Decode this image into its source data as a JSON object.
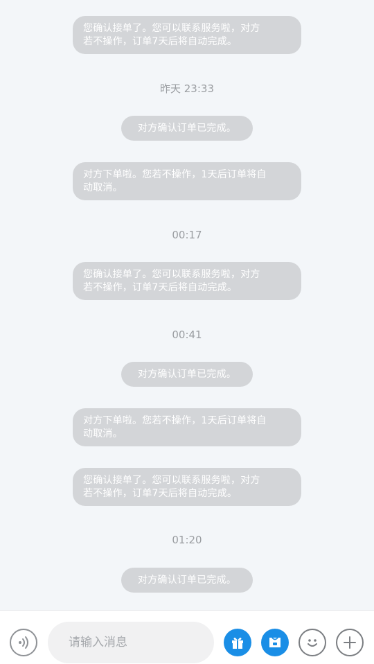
{
  "messages": {
    "m1": {
      "line1": "您确认接单了。您可以联系服务啦，对方",
      "line2": "若不操作，订单7天后将自动完成。"
    },
    "t1": "昨天 23:33",
    "m2": "对方确认订单已完成。",
    "m3": {
      "line1": "对方下单啦。您若不操作，1天后订单将自",
      "line2": "动取消。"
    },
    "t2": "00:17",
    "m4": {
      "line1": "您确认接单了。您可以联系服务啦，对方",
      "line2": "若不操作，订单7天后将自动完成。"
    },
    "t3": "00:41",
    "m5": "对方确认订单已完成。",
    "m6": {
      "line1": "对方下单啦。您若不操作，1天后订单将自",
      "line2": "动取消。"
    },
    "m7": {
      "line1": "您确认接单了。您可以联系服务啦，对方",
      "line2": "若不操作，订单7天后将自动完成。"
    },
    "t4": "01:20",
    "m8": "对方确认订单已完成。"
  },
  "toolbar": {
    "input_placeholder": "请输入消息",
    "icons": [
      "voice-icon",
      "gift-icon",
      "coupon-icon",
      "emoji-icon",
      "plus-icon"
    ]
  },
  "colors": {
    "background": "#f3f6f9",
    "bubble": "#d3d5d8",
    "accent": "#1a8ee6"
  }
}
